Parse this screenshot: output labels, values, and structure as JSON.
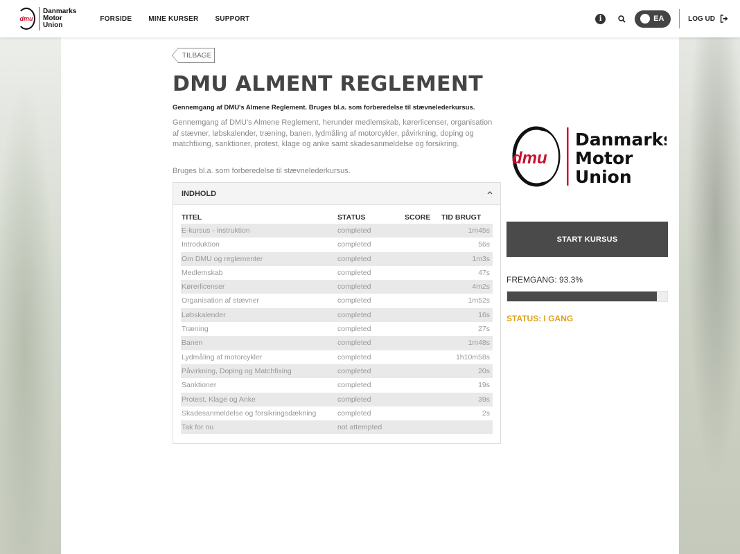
{
  "header": {
    "brand": {
      "mark": "dmu",
      "line1": "Danmarks",
      "line2": "Motor",
      "line3": "Union"
    },
    "nav": [
      "FORSIDE",
      "MINE KURSER",
      "SUPPORT"
    ],
    "user_initials": "EA",
    "logout_label": "LOG UD",
    "icons": [
      "info-icon",
      "search-icon",
      "logout-icon"
    ]
  },
  "course": {
    "back_label": "TILBAGE",
    "title": "DMU ALMENT REGLEMENT",
    "subtitle": "Gennemgang af DMU's Almene Reglement. Bruges bl.a. som forberedelse til stævnelederkursus.",
    "description": "Gennemgang af DMU's Almene Reglement, herunder medlemskab, kørerlicenser, organisation af stævner, løbskalender, træning, banen, lydmåling af motorcykler, påvirkning, doping og matchfixing, sanktioner, protest, klage og anke samt skadesanmeldelse og forsikring.",
    "description2": "Bruges bl.a. som forberedelse til stævnelederkursus."
  },
  "contents": {
    "heading": "INDHOLD",
    "columns": {
      "title": "TITEL",
      "status": "STATUS",
      "score": "SCORE",
      "time": "TID BRUGT"
    },
    "rows": [
      {
        "title": "E-kursus - instruktion",
        "status": "completed",
        "score": "",
        "time": "1m45s"
      },
      {
        "title": "Introduktion",
        "status": "completed",
        "score": "",
        "time": "56s"
      },
      {
        "title": "Om DMU og reglementer",
        "status": "completed",
        "score": "",
        "time": "1m3s"
      },
      {
        "title": "Medlemskab",
        "status": "completed",
        "score": "",
        "time": "47s"
      },
      {
        "title": "Kørerlicenser",
        "status": "completed",
        "score": "",
        "time": "4m2s"
      },
      {
        "title": "Organisation af stævner",
        "status": "completed",
        "score": "",
        "time": "1m52s"
      },
      {
        "title": "Løbskalender",
        "status": "completed",
        "score": "",
        "time": "16s"
      },
      {
        "title": "Træning",
        "status": "completed",
        "score": "",
        "time": "27s"
      },
      {
        "title": "Banen",
        "status": "completed",
        "score": "",
        "time": "1m48s"
      },
      {
        "title": "Lydmåling af motorcykler",
        "status": "completed",
        "score": "",
        "time": "1h10m58s"
      },
      {
        "title": "Påvirkning, Doping og Matchfixing",
        "status": "completed",
        "score": "",
        "time": "20s"
      },
      {
        "title": "Sanktioner",
        "status": "completed",
        "score": "",
        "time": "19s"
      },
      {
        "title": "Protest, Klage og Anke",
        "status": "completed",
        "score": "",
        "time": "39s"
      },
      {
        "title": "Skadesanmeldelse og forsikringsdækning",
        "status": "completed",
        "score": "",
        "time": "2s"
      },
      {
        "title": "Tak for nu",
        "status": "not attempted",
        "score": "",
        "time": ""
      }
    ]
  },
  "sidebar": {
    "logo": {
      "mark": "dmu",
      "line1": "Danmarks",
      "line2": "Motor",
      "line3": "Union"
    },
    "start_label": "START KURSUS",
    "progress_label": "FREMGANG: 93.3%",
    "progress_value": 0.933,
    "status_label": "STATUS: I GANG"
  },
  "colors": {
    "brand_red": "#c8102e",
    "status_orange": "#e0a11b",
    "button_dark": "#4a4a4a"
  }
}
